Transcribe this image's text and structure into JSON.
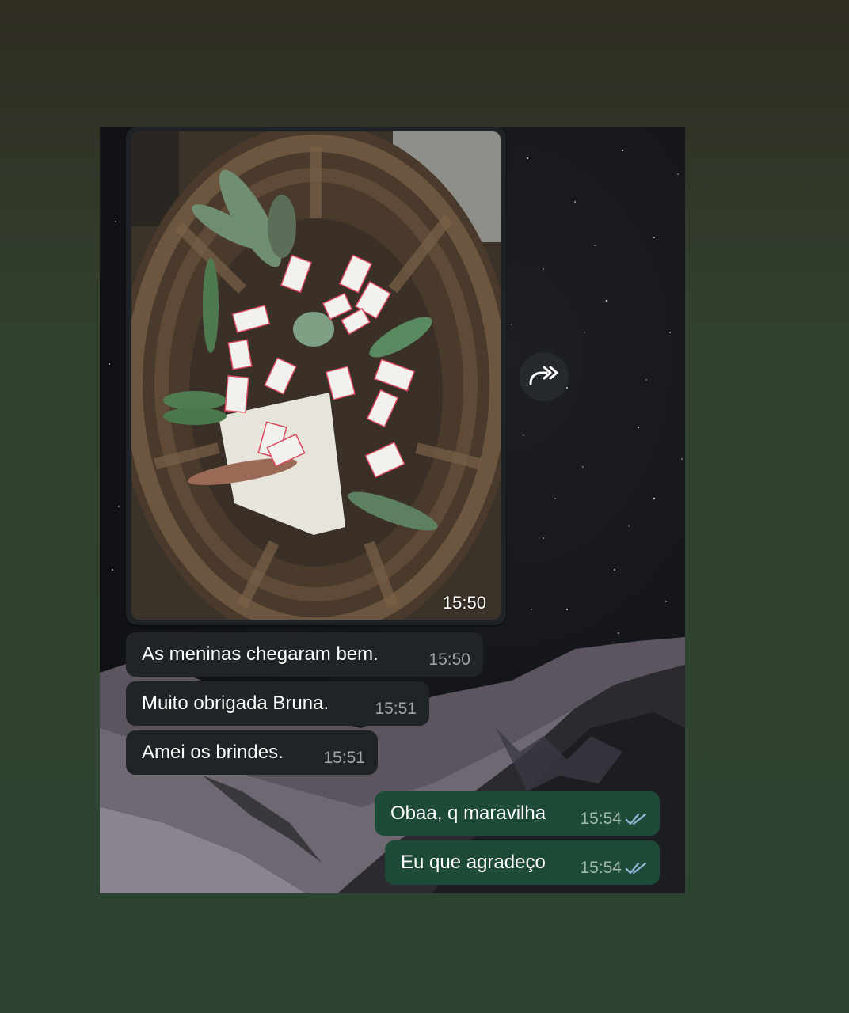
{
  "photo": {
    "time": "15:50"
  },
  "forward": {
    "icon": "forward-icon"
  },
  "messages": [
    {
      "direction": "in",
      "text": "As meninas chegaram bem.",
      "time": "15:50"
    },
    {
      "direction": "in",
      "text": "Muito obrigada Bruna.",
      "time": "15:51"
    },
    {
      "direction": "in",
      "text": "Amei os brindes.",
      "time": "15:51"
    },
    {
      "direction": "out",
      "text": "Obaa, q maravilha",
      "time": "15:54",
      "status_icon": "double-check-icon"
    },
    {
      "direction": "out",
      "text": "Eu que agradeço",
      "time": "15:54",
      "status_icon": "double-check-icon"
    }
  ],
  "colors": {
    "incoming_bubble": "#1f2427",
    "outgoing_bubble": "#1e4a38",
    "read_ticks": "#8fb8d6"
  }
}
